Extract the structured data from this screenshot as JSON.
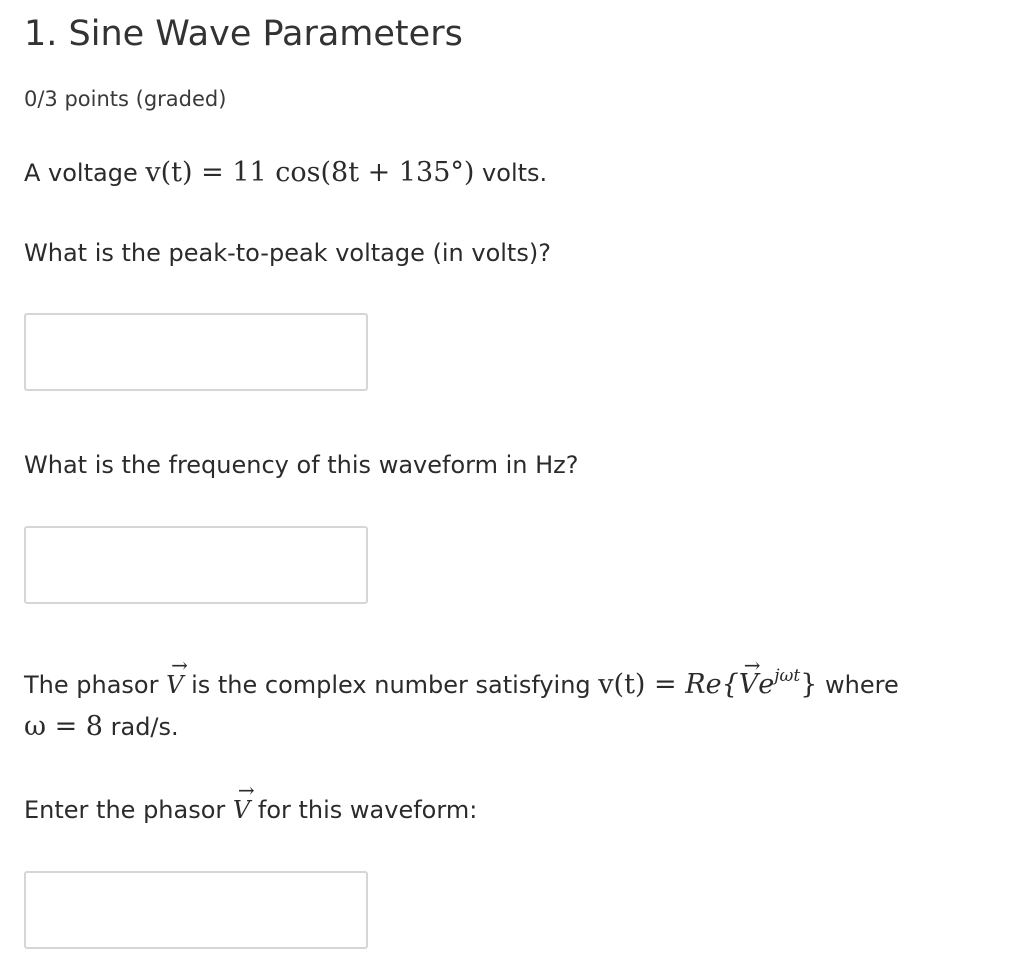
{
  "problem": {
    "title": "1. Sine Wave Parameters",
    "points": "0/3 points (graded)"
  },
  "intro": {
    "prefix": "A voltage ",
    "equation": "v(t) = 11 cos(8t + 135°)",
    "suffix": " volts."
  },
  "questions": [
    {
      "prompt": "What is the peak-to-peak voltage (in volts)?",
      "input_value": ""
    },
    {
      "prompt": "What is the frequency of this waveform in Hz?",
      "input_value": ""
    },
    {
      "prompt_prefix": "Enter the phasor ",
      "prompt_symbol": "V",
      "prompt_suffix": " for this waveform:",
      "input_value": ""
    }
  ],
  "phasor_definition": {
    "prefix": "The phasor ",
    "symbol": "V",
    "middle": " is the complex number satisfying ",
    "equation_lhs": "v(t) = ",
    "equation_re": "Re{",
    "equation_symbol": "V",
    "equation_exp_base": "e",
    "equation_exp_power": "jωt",
    "equation_close": "}",
    "suffix": " where",
    "line2_math": "ω = 8",
    "line2_text": " rad/s."
  }
}
